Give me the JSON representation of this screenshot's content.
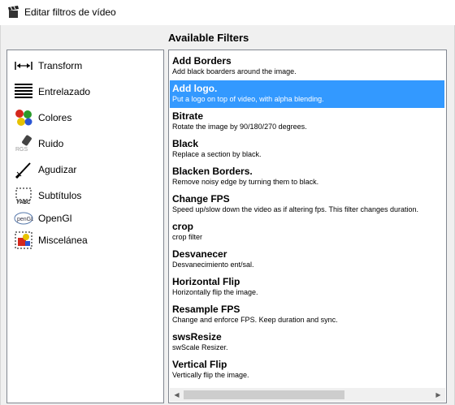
{
  "window": {
    "title": "Editar filtros de vídeo",
    "icon": "clapperboard-icon"
  },
  "heading": "Available Filters",
  "categories": [
    {
      "label": "Transform",
      "icon": "arrows-horizontal-icon"
    },
    {
      "label": "Entrelazado",
      "icon": "interlace-lines-icon"
    },
    {
      "label": "Colores",
      "icon": "color-balls-icon"
    },
    {
      "label": "Ruido",
      "icon": "noise-icon"
    },
    {
      "label": "Agudizar",
      "icon": "sharpen-knife-icon"
    },
    {
      "label": "Subtítulos",
      "icon": "subtitle-icon"
    },
    {
      "label": "OpenGl",
      "icon": "opengl-icon"
    },
    {
      "label": "Miscelánea",
      "icon": "misc-shapes-icon"
    }
  ],
  "filters": [
    {
      "name": "Add Borders",
      "desc": "Add black boarders around the image."
    },
    {
      "name": "Add logo.",
      "desc": "Put a logo on top of video, with alpha blending.",
      "selected": true
    },
    {
      "name": "Bitrate",
      "desc": "Rotate the image by 90/180/270 degrees."
    },
    {
      "name": "Black",
      "desc": "Replace a section by black."
    },
    {
      "name": "Blacken Borders.",
      "desc": "Remove noisy edge by turning them to black."
    },
    {
      "name": "Change FPS",
      "desc": "Speed up/slow down the video as if altering fps. This filter changes duration."
    },
    {
      "name": "crop",
      "desc": "crop filter"
    },
    {
      "name": "Desvanecer",
      "desc": "Desvanecimiento ent/sal."
    },
    {
      "name": "Horizontal Flip",
      "desc": "Horizontally flip the image."
    },
    {
      "name": "Resample FPS",
      "desc": "Change and enforce FPS. Keep duration and sync."
    },
    {
      "name": "swsResize",
      "desc": "swScale Resizer."
    },
    {
      "name": "Vertical Flip",
      "desc": "Vertically flip the image."
    }
  ],
  "colors": {
    "selection": "#3399ff",
    "border": "#828790"
  }
}
